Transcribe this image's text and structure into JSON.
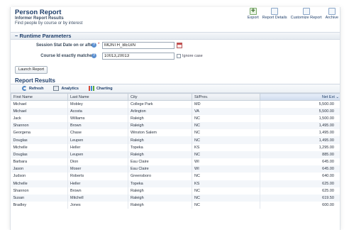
{
  "header": {
    "title": "Person Report",
    "subtitle": "Informer Report Results",
    "description": "Find people by course or by interest"
  },
  "toolbar": {
    "items": [
      {
        "label": "Export",
        "icon": "export-icon"
      },
      {
        "label": "Report Details",
        "icon": "report-details-icon"
      },
      {
        "label": "Customize Report",
        "icon": "customize-report-icon"
      },
      {
        "label": "Archive",
        "icon": "archive-icon"
      }
    ]
  },
  "runtime": {
    "section_title": "Runtime Parameters",
    "collapse_symbol": "−",
    "start_date": {
      "label": "Session Stat Date on or after",
      "required": "*",
      "value": "MONTH_BEGIN"
    },
    "course_id": {
      "label": "Course Id exactly matches",
      "value": "10013,20013",
      "checkbox_label": "Ignore case"
    },
    "help_symbol": "?",
    "launch_button": "Launch Report"
  },
  "results": {
    "title": "Report Results",
    "actions": [
      "Refresh",
      "Analytics",
      "Charting"
    ],
    "columns": [
      "First Name",
      "Last Name",
      "City",
      "St/Prov.",
      "Net Ext ⌄"
    ],
    "rows": [
      [
        "Michael",
        "Mobley",
        "College Park",
        "MD",
        "5,500.00"
      ],
      [
        "Michael",
        "Acosta",
        "Arlington",
        "VA",
        "5,500.00"
      ],
      [
        "Jack",
        "Williams",
        "Raleigh",
        "NC",
        "1,500.00"
      ],
      [
        "Shannon",
        "Brown",
        "Raleigh",
        "NC",
        "1,495.00"
      ],
      [
        "Georgena",
        "Chase",
        "Winston Salem",
        "NC",
        "1,495.00"
      ],
      [
        "Douglas",
        "Leupen",
        "Raleigh",
        "NC",
        "1,495.00"
      ],
      [
        "Michelle",
        "Heller",
        "Topeka",
        "KS",
        "1,295.00"
      ],
      [
        "Douglas",
        "Leupen",
        "Raleigh",
        "NC",
        "885.00"
      ],
      [
        "Barbara",
        "Dion",
        "Eau Claire",
        "WI",
        "645.00"
      ],
      [
        "Jason",
        "Moser",
        "Eau Claire",
        "WI",
        "645.00"
      ],
      [
        "Judson",
        "Roberts",
        "Greensboro",
        "NC",
        "640.00"
      ],
      [
        "Michelle",
        "Heller",
        "Topeka",
        "KS",
        "625.00"
      ],
      [
        "Shannon",
        "Brown",
        "Raleigh",
        "NC",
        "625.00"
      ],
      [
        "Susan",
        "Mitchell",
        "Raleigh",
        "NC",
        "619.50"
      ],
      [
        "Bradley",
        "Jones",
        "Raleigh",
        "NC",
        "600.00"
      ]
    ]
  },
  "colors": {
    "title_blue": "#1f3f6b",
    "required_red": "#c02020",
    "help_blue": "#5b8fd0"
  }
}
